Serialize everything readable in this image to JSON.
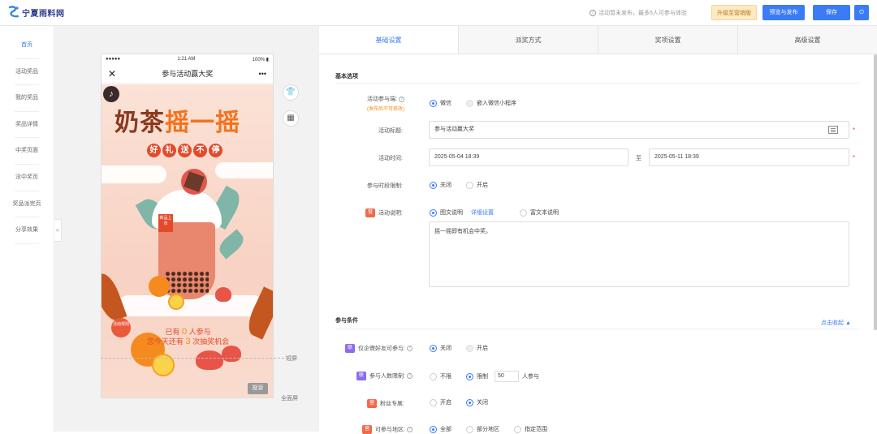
{
  "header": {
    "logo_text": "宁夏雨料网",
    "status_note": "活动暂未发布，最多5人可参与体验",
    "upgrade_label": "升级至营销版",
    "preview_publish_label": "预览与发布",
    "save_label": "保存",
    "power_icon": "⏻"
  },
  "sidebar": {
    "items": [
      {
        "label": "首页"
      },
      {
        "label": "活动奖品"
      },
      {
        "label": "我的奖品"
      },
      {
        "label": "奖品详情"
      },
      {
        "label": "中奖页面"
      },
      {
        "label": "没中奖页"
      },
      {
        "label": "奖品派完页"
      },
      {
        "label": "分享效果"
      }
    ],
    "collapse_glyph": "«"
  },
  "phone": {
    "signal": "●●●●●",
    "time": "1:21 AM",
    "battery": "100% ▮",
    "title": "参与活动赢大奖",
    "close_glyph": "✕",
    "more_glyph": "•••",
    "music_glyph": "♪",
    "poster_title_a": "奶茶",
    "poster_title_b": "摇一摇",
    "badges": [
      "好",
      "礼",
      "送",
      "不",
      "停"
    ],
    "tag_text": "新品上市",
    "stamp_text": "活动规则",
    "joined_prefix": "已有",
    "joined_count": "0",
    "joined_suffix": "人参与",
    "chances_prefix": "您今天还有",
    "chances_count": "3",
    "chances_suffix": "次抽奖机会",
    "toudi_label": "投诉"
  },
  "canvas": {
    "short_screen_label": "短屏",
    "full_screen_label": "全面屏",
    "tool_shirt": "👕",
    "tool_grid": "▦"
  },
  "tabs": [
    {
      "label": "基础设置"
    },
    {
      "label": "派奖方式"
    },
    {
      "label": "奖项设置"
    },
    {
      "label": "高级设置"
    }
  ],
  "basic": {
    "section_title": "基本选项",
    "platform_label": "活动参与端:",
    "platform_note": "(发布后不可修改)",
    "platform_opt1": "微信",
    "platform_opt2": "嵌入微信小程序",
    "title_label": "活动标题:",
    "title_value": "参与活动赢大奖",
    "time_label": "活动时间:",
    "time_start": "2025-05-04 18:39",
    "time_sep": "至",
    "time_end": "2025-05-11 18:39",
    "period_label": "参与时段限制:",
    "period_opt1": "关闭",
    "period_opt2": "开启",
    "desc_label": "活动说明:",
    "desc_badge": "营",
    "desc_opt1": "图文说明",
    "desc_link": "详细设置",
    "desc_opt2": "富文本说明",
    "desc_text": "摇一摇即有机会中奖。",
    "required_mark": "*"
  },
  "conditions": {
    "section_title": "参与条件",
    "collapse_link": "点击收起 ▲",
    "friend_badge": "联",
    "friend_label": "仅企微好友可参与:",
    "friend_opt1": "关闭",
    "friend_opt2": "开启",
    "count_badge": "联",
    "count_label": "参与人数限制:",
    "count_opt1": "不限",
    "count_opt2": "限制",
    "count_value": "50",
    "count_unit": "人参与",
    "fans_badge": "营",
    "fans_label": "粉丝专属:",
    "fans_opt1": "开启",
    "fans_opt2": "关闭",
    "region_badge": "营",
    "region_label": "可参与地区:",
    "region_opt1": "全部",
    "region_opt2": "部分地区",
    "region_opt3": "指定范围"
  }
}
